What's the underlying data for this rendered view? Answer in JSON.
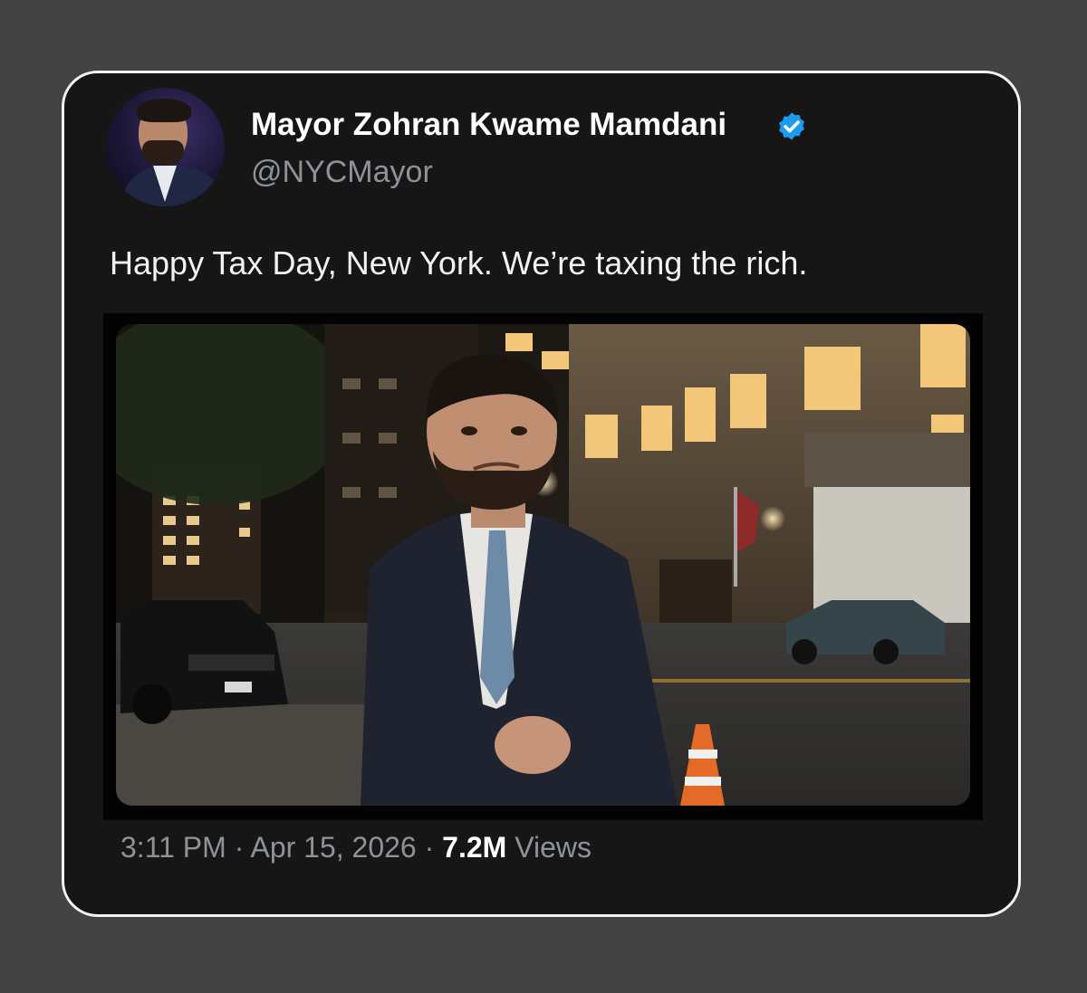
{
  "tweet": {
    "author_name": "Mayor Zohran Kwame Mamdani",
    "handle": "@NYCMayor",
    "verified_icon": "verified-badge-icon",
    "verified_color": "#1d9bf0",
    "text": "Happy Tax Day, New York. We’re taxing the rich.",
    "time": "3:11 PM",
    "separator": "·",
    "date": "Apr 15, 2026",
    "views_count": "7.2M",
    "views_label": "Views"
  },
  "colors": {
    "page_background": "#434343",
    "card_background": "#161616",
    "card_border": "#f3f3f3",
    "secondary_text": "#8e9399"
  }
}
